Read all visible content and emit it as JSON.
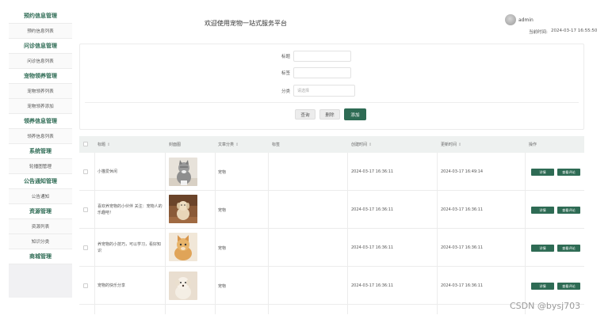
{
  "sidebar": {
    "items": [
      {
        "label": "预约信息管理",
        "group": true
      },
      {
        "label": "预约信息列表",
        "group": false
      },
      {
        "label": "问诊信息管理",
        "group": true
      },
      {
        "label": "问诊信息列表",
        "group": false
      },
      {
        "label": "宠物领养管理",
        "group": true
      },
      {
        "label": "宠物领养列表",
        "group": false
      },
      {
        "label": "宠物领养添加",
        "group": false
      },
      {
        "label": "领养信息管理",
        "group": true
      },
      {
        "label": "领养信息列表",
        "group": false
      },
      {
        "label": "系统管理",
        "group": true
      },
      {
        "label": "轮播图管理",
        "group": false
      },
      {
        "label": "公告通知管理",
        "group": true
      },
      {
        "label": "公告通知",
        "group": false
      },
      {
        "label": "资源管理",
        "group": true
      },
      {
        "label": "资源列表",
        "group": false
      },
      {
        "label": "知识分类",
        "group": false
      },
      {
        "label": "商城管理",
        "group": true
      }
    ]
  },
  "header": {
    "title": "欢迎使用宠物一站式服务平台",
    "user": "admin",
    "time_label": "当前时间:",
    "time_value": "2024-03-17 16:55:50"
  },
  "search": {
    "fields": [
      {
        "label": "标题",
        "value": "",
        "placeholder": ""
      },
      {
        "label": "标签",
        "value": "",
        "placeholder": ""
      },
      {
        "label": "分类",
        "value": "",
        "placeholder": "请选择"
      }
    ],
    "buttons": {
      "query": "查询",
      "delete": "删除",
      "add": "添加"
    }
  },
  "table": {
    "headers": [
      "标题",
      "封面图",
      "文章分类",
      "标签",
      "创建时间",
      "更新时间",
      "操作"
    ],
    "sort_glyph": "⇕",
    "action_labels": {
      "detail": "详情",
      "comment": "查看评论"
    },
    "rows": [
      {
        "title": "小猫爱休闲",
        "category": "宠物",
        "tags": "",
        "created": "2024-03-17 16:36:11",
        "updated": "2024-03-17 16:49:14",
        "image": "cat-gray"
      },
      {
        "title": "喜欢养宠物的小伙伴 关注：宠物人的乐趣吧！",
        "category": "宠物",
        "tags": "",
        "created": "2024-03-17 16:36:11",
        "updated": "2024-03-17 16:36:11",
        "image": "dog-tan"
      },
      {
        "title": "养宠物的小技巧，可以学习，看好知识",
        "category": "宠物",
        "tags": "",
        "created": "2024-03-17 16:36:11",
        "updated": "2024-03-17 16:36:11",
        "image": "cat-orange"
      },
      {
        "title": "宠物的快乐分享",
        "category": "宠物",
        "tags": "",
        "created": "2024-03-17 16:36:11",
        "updated": "2024-03-17 16:36:11",
        "image": "dog-white"
      }
    ]
  },
  "watermark": "CSDN @bysj703",
  "colors": {
    "accent": "#2e6b54",
    "header_bg": "#eef1f0",
    "sidebar_bg": "#f1f1f3"
  }
}
